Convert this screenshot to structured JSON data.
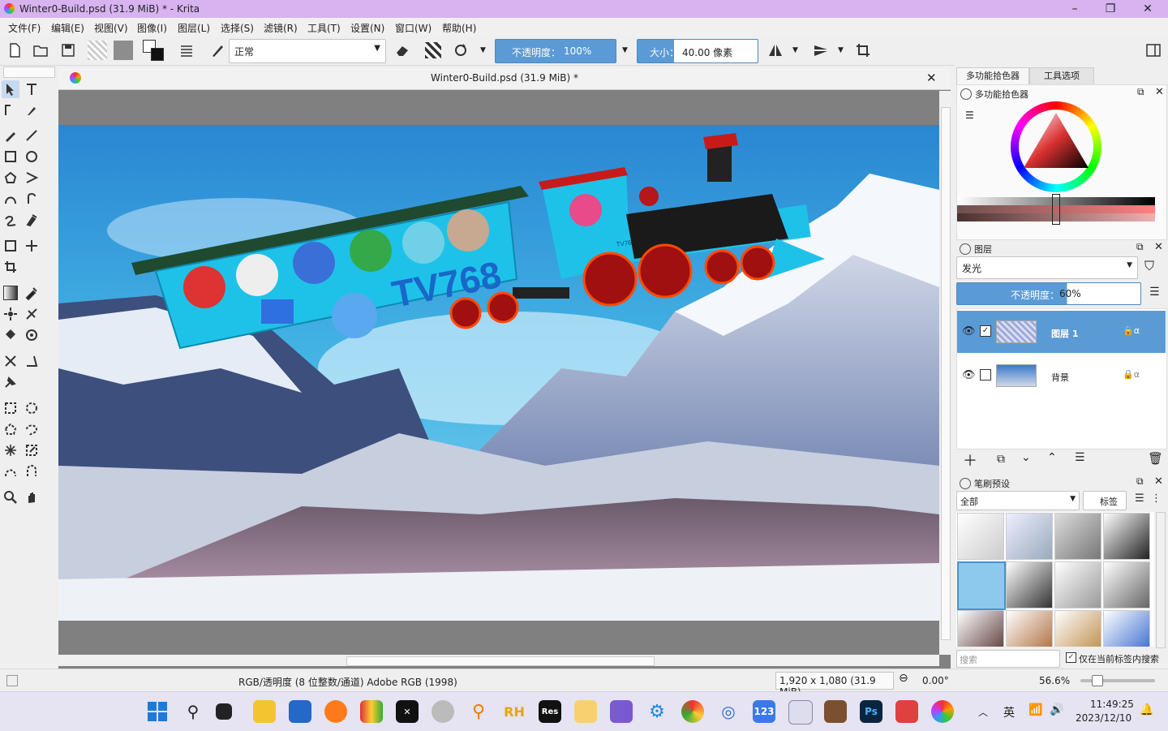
{
  "window": {
    "title": "Winter0-Build.psd (31.9 MiB) * - Krita",
    "minimize": "–",
    "maximize": "❐",
    "close": "✕"
  },
  "menu": [
    "文件(F)",
    "编辑(E)",
    "视图(V)",
    "图像(I)",
    "图层(L)",
    "选择(S)",
    "滤镜(R)",
    "工具(T)",
    "设置(N)",
    "窗口(W)",
    "帮助(H)"
  ],
  "toolbar": {
    "blend_mode": "正常",
    "opacity_label": "不透明度：",
    "opacity_value": "100%",
    "size_label": "大小：",
    "size_value": "40.00 像素"
  },
  "document": {
    "tab_title": "Winter0-Build.psd (31.9 MiB) *",
    "close": "✕"
  },
  "canvas_art": {
    "train_logo": "TV768",
    "cab_badge": "TV768 Rail"
  },
  "statusbar": {
    "color_profile": "RGB/透明度 (8 位整数/通道)  Adobe RGB (1998)",
    "dimensions": "1,920 x 1,080 (31.9 MiB)",
    "rotation": "0.00°",
    "zoom": "56.6%"
  },
  "dock": {
    "tabs": [
      "多功能拾色器",
      "工具选项"
    ],
    "color_selector_title": "多功能拾色器",
    "layers_title": "图层",
    "layer_blend": "发光",
    "layer_opacity_label": "不透明度：",
    "layer_opacity_value": "60%",
    "layers": [
      {
        "name": "图层 1",
        "visible": true,
        "checked": true,
        "selected": true
      },
      {
        "name": "背景",
        "visible": true,
        "checked": false,
        "selected": false
      }
    ],
    "brush_title": "笔刷预设",
    "brush_filter": "全部",
    "brush_tag": "标签",
    "brush_search_placeholder": "搜索",
    "brush_search_option": "仅在当前标签内搜索"
  },
  "taskbar": {
    "ime": "英",
    "time": "11:49:25",
    "date": "2023/12/10",
    "apps": [
      "windows-start",
      "search",
      "task-view",
      "file-explorer",
      "store",
      "firefox",
      "winrar",
      "capcut",
      "dvd",
      "magnifier",
      "resource-hacker",
      "res",
      "photos",
      "anime-app",
      "settings",
      "chrome",
      "fingerprint",
      "calc-123",
      "monitor",
      "photo-viewer",
      "photoshop",
      "snip",
      "krita"
    ]
  },
  "colors": {
    "titlebar": "#d7b3f0",
    "accent": "#5b9bd5",
    "selected_layer": "#5b9bd5"
  }
}
